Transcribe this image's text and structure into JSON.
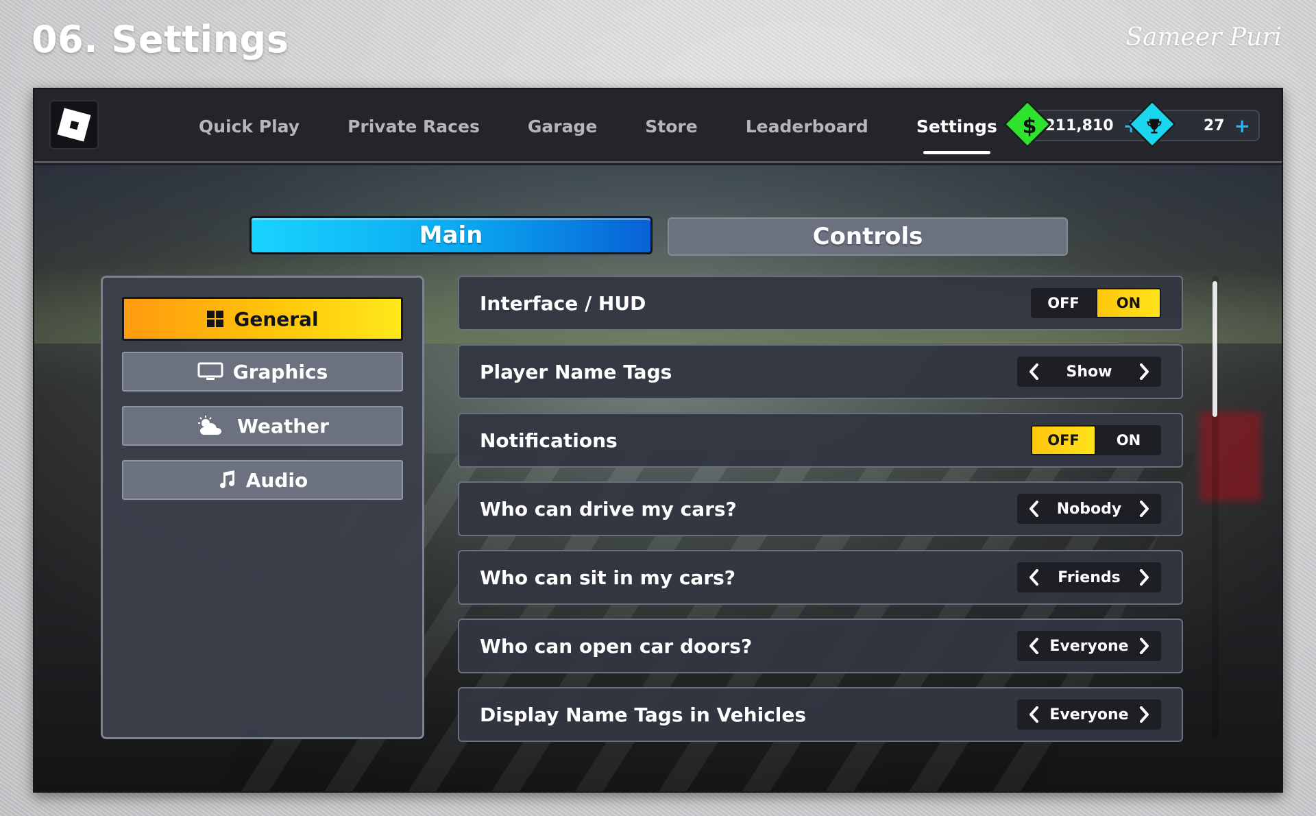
{
  "header": {
    "title": "06. Settings",
    "signature": "Sameer Puri"
  },
  "app": {
    "logo_icon": "roblox-logo-icon"
  },
  "nav": {
    "items": [
      {
        "label": "Quick Play"
      },
      {
        "label": "Private Races"
      },
      {
        "label": "Garage"
      },
      {
        "label": "Store"
      },
      {
        "label": "Leaderboard"
      },
      {
        "label": "Settings",
        "active": true
      }
    ]
  },
  "currency": {
    "money": {
      "icon": "dollar-icon",
      "value": "211,810",
      "plus": "+",
      "color": "#2ee22e"
    },
    "trophies": {
      "icon": "trophy-icon",
      "value": "27",
      "plus": "+",
      "color": "#1ad6ee"
    }
  },
  "tabs": {
    "main": "Main",
    "controls": "Controls",
    "active": "Main"
  },
  "sidebar": {
    "items": [
      {
        "label": "General",
        "icon": "grid-icon",
        "active": true
      },
      {
        "label": "Graphics",
        "icon": "monitor-icon"
      },
      {
        "label": "Weather",
        "icon": "partly-cloudy-icon"
      },
      {
        "label": "Audio",
        "icon": "music-note-icon"
      }
    ]
  },
  "settings": {
    "rows": [
      {
        "label": "Interface / HUD",
        "type": "toggle",
        "off": "OFF",
        "on": "ON",
        "value": "ON"
      },
      {
        "label": "Player Name Tags",
        "type": "selector",
        "value": "Show"
      },
      {
        "label": "Notifications",
        "type": "toggle",
        "off": "OFF",
        "on": "ON",
        "value": "OFF"
      },
      {
        "label": "Who can drive my cars?",
        "type": "selector",
        "value": "Nobody"
      },
      {
        "label": "Who can sit in my cars?",
        "type": "selector",
        "value": "Friends"
      },
      {
        "label": "Who can open car doors?",
        "type": "selector",
        "value": "Everyone"
      },
      {
        "label": "Display Name Tags in Vehicles",
        "type": "selector",
        "value": "Everyone"
      }
    ]
  },
  "colors": {
    "accent_blue": "#0aa6f0",
    "accent_yellow": "#ffd21a",
    "panel": "#3a3e4a"
  }
}
